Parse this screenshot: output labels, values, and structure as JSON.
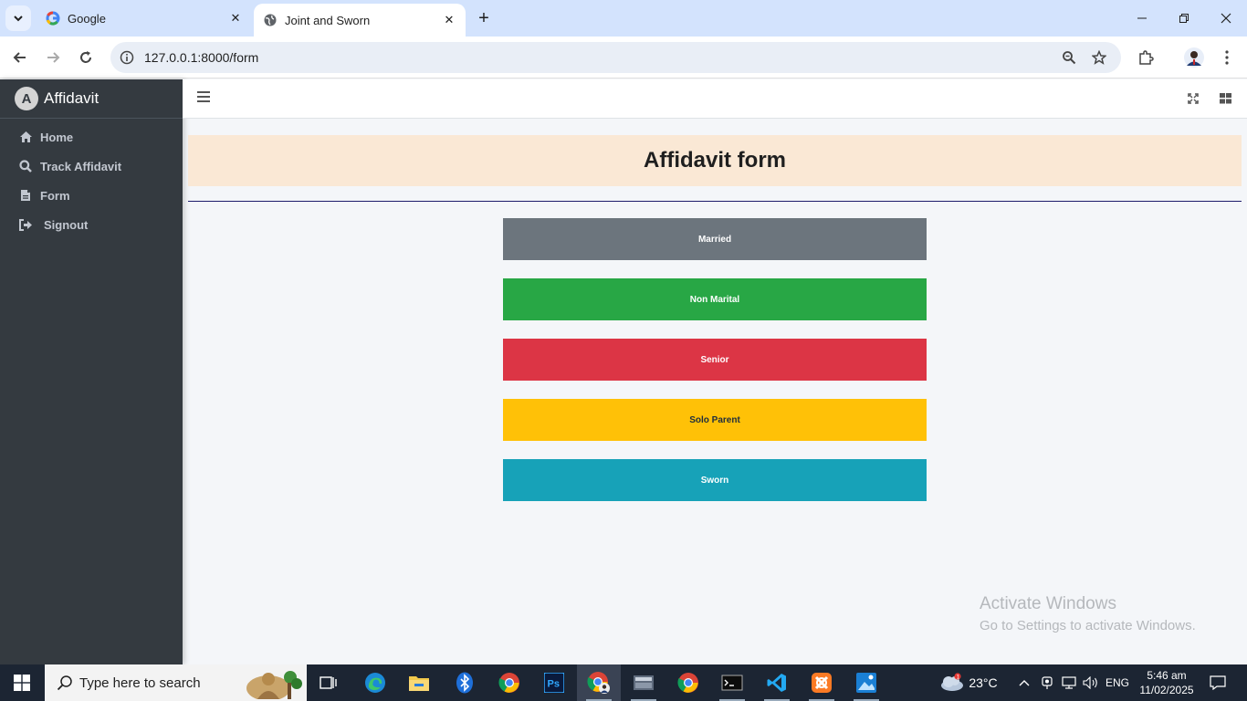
{
  "browser": {
    "tabs": [
      {
        "title": "Google",
        "active": false
      },
      {
        "title": "Joint and Sworn",
        "active": true
      }
    ],
    "url": "127.0.0.1:8000/form"
  },
  "sidebar": {
    "brand": "Affidavit",
    "brand_logo_letter": "A",
    "items": [
      {
        "label": "Home",
        "icon": "home-icon"
      },
      {
        "label": "Track Affidavit",
        "icon": "search-icon"
      },
      {
        "label": "Form",
        "icon": "file-icon"
      },
      {
        "label": "Signout",
        "icon": "signout-icon"
      }
    ]
  },
  "main": {
    "title": "Affidavit form",
    "options": [
      {
        "label": "Married",
        "color": "#6c757d",
        "text_color": "#ffffff"
      },
      {
        "label": "Non Marital",
        "color": "#28a745",
        "text_color": "#ffffff"
      },
      {
        "label": "Senior",
        "color": "#dc3545",
        "text_color": "#ffffff"
      },
      {
        "label": "Solo Parent",
        "color": "#ffc107",
        "text_color": "#1f2d3d"
      },
      {
        "label": "Sworn",
        "color": "#17a2b8",
        "text_color": "#ffffff"
      }
    ]
  },
  "watermark": {
    "line1": "Activate Windows",
    "line2": "Go to Settings to activate Windows."
  },
  "taskbar": {
    "search_placeholder": "Type here to search",
    "weather": "23°C",
    "language": "ENG",
    "time": "5:46 am",
    "date": "11/02/2025",
    "weather_badge": "1"
  }
}
